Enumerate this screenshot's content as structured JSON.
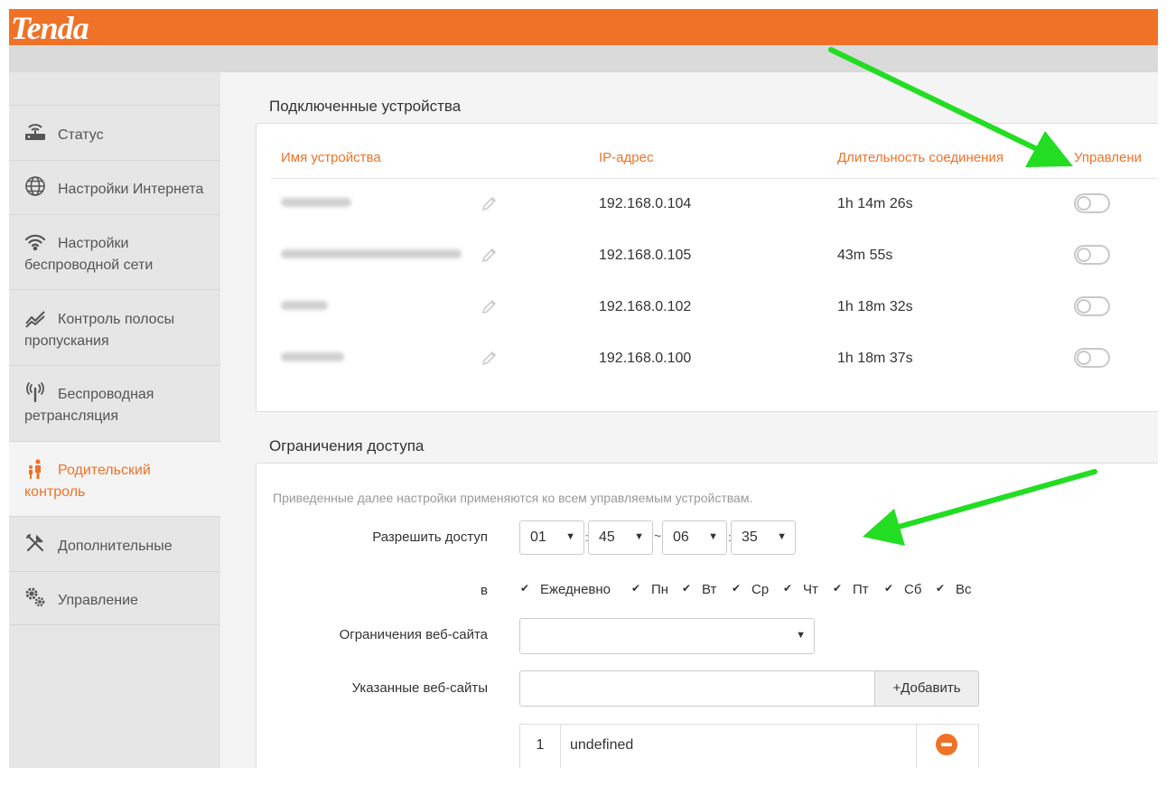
{
  "brand": {
    "logo": "Tenda",
    "accent": "#ef7227"
  },
  "sidebar": {
    "items": [
      {
        "label": "Статус",
        "icon": "router-icon",
        "active": false
      },
      {
        "label": "Настройки Интернета",
        "icon": "globe-icon",
        "active": false
      },
      {
        "label": "Настройки\nбеспроводной сети",
        "icon": "wifi-icon",
        "active": false
      },
      {
        "label": "Контроль полосы\nпропускания",
        "icon": "bandwidth-icon",
        "active": false
      },
      {
        "label": "Беспроводная\nретрансляция",
        "icon": "antenna-icon",
        "active": false
      },
      {
        "label": "Родительский\nконтроль",
        "icon": "family-icon",
        "active": true
      },
      {
        "label": "Дополнительные",
        "icon": "tools-icon",
        "active": false
      },
      {
        "label": "Управление",
        "icon": "gears-icon",
        "active": false
      }
    ]
  },
  "devices": {
    "title": "Подключенные устройства",
    "columns": {
      "name": "Имя устройства",
      "ip": "IP-адрес",
      "duration": "Длительность соединения",
      "manage": "Управлени"
    },
    "rows": [
      {
        "ip": "192.168.0.104",
        "duration": "1h 14m 26s",
        "managed": false
      },
      {
        "ip": "192.168.0.105",
        "duration": "43m 55s",
        "managed": false
      },
      {
        "ip": "192.168.0.102",
        "duration": "1h 18m 32s",
        "managed": false
      },
      {
        "ip": "192.168.0.100",
        "duration": "1h 18m 37s",
        "managed": false
      }
    ]
  },
  "access": {
    "title": "Ограничения доступа",
    "note": "Приведенные далее настройки применяются ко всем управляемым устройствам.",
    "allow_label": "Разрешить доступ",
    "time": {
      "start_h": "01",
      "start_m": "45",
      "range_sep": "~",
      "end_h": "06",
      "end_m": "35",
      "colon": ":"
    },
    "on_label": "в",
    "days": [
      {
        "label": "Ежедневно",
        "checked": true
      },
      {
        "label": "Пн",
        "checked": true
      },
      {
        "label": "Вт",
        "checked": true
      },
      {
        "label": "Ср",
        "checked": true
      },
      {
        "label": "Чт",
        "checked": true
      },
      {
        "label": "Пт",
        "checked": true
      },
      {
        "label": "Сб",
        "checked": true
      },
      {
        "label": "Вс",
        "checked": true
      }
    ],
    "web_restrict_label": "Ограничения веб-сайта",
    "web_restrict_value": "",
    "sites_label": "Указанные веб-сайты",
    "sites_input_value": "",
    "add_label": "+Добавить",
    "sites": [
      {
        "index": "1",
        "value": "undefined"
      }
    ]
  },
  "annotations": {
    "arrow_color": "#22dd22"
  }
}
